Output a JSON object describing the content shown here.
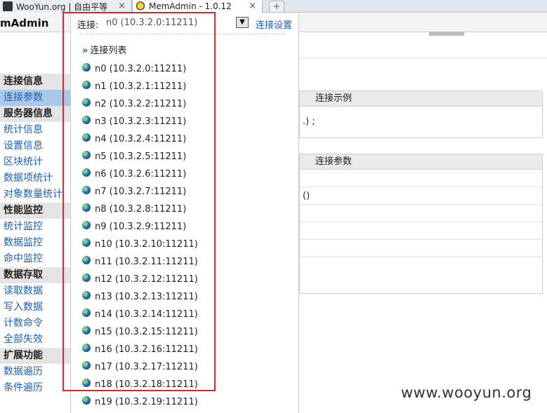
{
  "browser": {
    "tabs": [
      {
        "label": "WooYun.org | 自由平等"
      },
      {
        "label": "MemAdmin - 1.0.12"
      }
    ],
    "close_glyph": "×",
    "new_tab_glyph": "+"
  },
  "app": {
    "title": "mAdmin"
  },
  "sidebar": {
    "sections": [
      {
        "label": "连接信息",
        "items": [
          {
            "label": "连接参数",
            "active": true
          }
        ]
      },
      {
        "label": "服务器信息",
        "items": [
          {
            "label": "统计信息"
          },
          {
            "label": "设置信息"
          },
          {
            "label": "区块统计"
          },
          {
            "label": "数据项统计"
          },
          {
            "label": "对象数量统计"
          }
        ]
      },
      {
        "label": "性能监控",
        "items": [
          {
            "label": "统计监控"
          },
          {
            "label": "数据监控"
          },
          {
            "label": "命中监控"
          }
        ]
      },
      {
        "label": "数据存取",
        "items": [
          {
            "label": "读取数据"
          },
          {
            "label": "写入数据"
          },
          {
            "label": "计数命令"
          },
          {
            "label": "全部失效"
          }
        ]
      },
      {
        "label": "扩展功能",
        "items": [
          {
            "label": "数据遍历"
          },
          {
            "label": "条件遍历"
          }
        ]
      }
    ]
  },
  "dropdown": {
    "label": "连接:",
    "selected": "n0 (10.3.2.0:11211)",
    "arrow_glyph": "▼",
    "settings_label": "连接设置",
    "list_title_chevron": "»",
    "list_title": "连接列表",
    "connections": [
      "n0 (10.3.2.0:11211)",
      "n1 (10.3.2.1:11211)",
      "n2 (10.3.2.2:11211)",
      "n3 (10.3.2.3:11211)",
      "n4 (10.3.2.4:11211)",
      "n5 (10.3.2.5:11211)",
      "n6 (10.3.2.6:11211)",
      "n7 (10.3.2.7:11211)",
      "n8 (10.3.2.8:11211)",
      "n9 (10.3.2.9:11211)",
      "n10 (10.3.2.10:11211)",
      "n11 (10.3.2.11:11211)",
      "n12 (10.3.2.12:11211)",
      "n13 (10.3.2.13:11211)",
      "n14 (10.3.2.14:11211)",
      "n15 (10.3.2.15:11211)",
      "n16 (10.3.2.16:11211)",
      "n17 (10.3.2.17:11211)",
      "n18 (10.3.2.18:11211)",
      "n19 (10.3.2.19:11211)"
    ]
  },
  "content": {
    "example_panel": {
      "title": "连接示例",
      "code": ".) ;"
    },
    "params_panel": {
      "title": "连接参数",
      "rows": [
        "",
        "()",
        "",
        "",
        "",
        ""
      ]
    }
  },
  "watermark": "www.wooyun.org",
  "colors": {
    "highlight": "#e0262b",
    "link": "#1a5fb4",
    "active_item": "#a9c7e6"
  }
}
